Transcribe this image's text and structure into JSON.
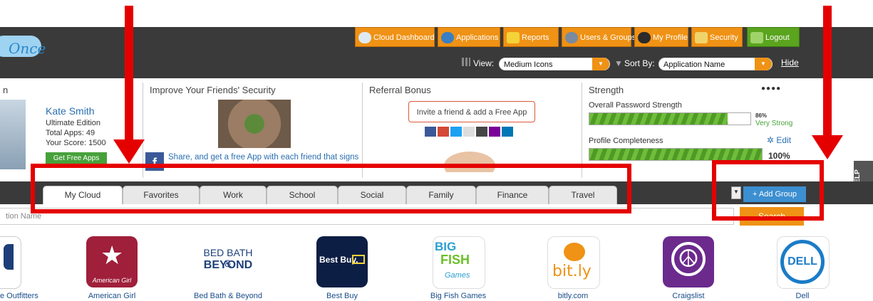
{
  "logo": {
    "text": "Once"
  },
  "nav": [
    {
      "label": "Cloud Dashboard",
      "icon": "cloud-icon"
    },
    {
      "label": "Applications",
      "icon": "globe-icon"
    },
    {
      "label": "Reports",
      "icon": "reports-icon"
    },
    {
      "label": "Users & Groups",
      "icon": "users-icon"
    },
    {
      "label": "My Profile",
      "icon": "profile-icon"
    },
    {
      "label": "Security",
      "icon": "lock-icon"
    },
    {
      "label": "Logout",
      "icon": "key-icon"
    }
  ],
  "toolbar": {
    "view_label": "View:",
    "view_value": "Medium Icons",
    "sort_label": "Sort By:",
    "sort_value": "Application Name",
    "hide_label": "Hide"
  },
  "profile": {
    "title_fragment": "n",
    "name": "Kate Smith",
    "edition": "Ultimate Edition",
    "total_apps": "Total Apps: 49",
    "score": "Your Score: 1500",
    "get_free_apps": "Get Free Apps"
  },
  "friends": {
    "title": "Improve Your Friends' Security",
    "share_text": "Share, and get a free App with each friend that signs"
  },
  "referral": {
    "title": "Referral Bonus",
    "invite": "Invite a friend & add a Free App"
  },
  "strength": {
    "title": "Strength",
    "password_label": "Overall Password Strength",
    "password_percent": "86%",
    "password_rating": "Very Strong",
    "password_value": 0.86,
    "profile_label": "Profile Completeness",
    "edit_label": "Edit",
    "profile_percent": "100%",
    "profile_value": 1.0
  },
  "tabs": [
    "My Cloud",
    "Favorites",
    "Work",
    "School",
    "Social",
    "Family",
    "Finance",
    "Travel"
  ],
  "add_group": "+ Add Group",
  "help": "HELP",
  "search": {
    "placeholder": "tion Name",
    "button": "Search"
  },
  "apps": [
    {
      "label": "e Outfitters"
    },
    {
      "label": "American Girl",
      "tile": "American Girl"
    },
    {
      "label": "Bed Bath & Beyond",
      "tile1": "BED BATH &",
      "tile2": "BEYOND"
    },
    {
      "label": "Best Buy",
      "tile": "Best Buy."
    },
    {
      "label": "Big Fish Games",
      "tile1": "BIG",
      "tile2": "FISH",
      "tile3": "Games"
    },
    {
      "label": "bitly.com",
      "tile": "bit.ly"
    },
    {
      "label": "Craigslist"
    },
    {
      "label": "Dell",
      "tile": "DELL"
    }
  ]
}
